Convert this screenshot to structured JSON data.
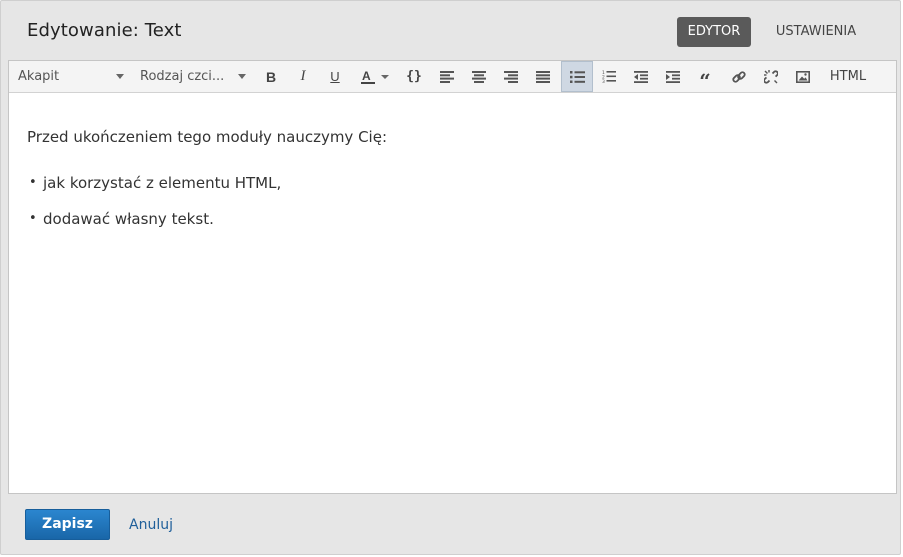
{
  "dialog": {
    "title": "Edytowanie: Text",
    "tabs": [
      {
        "label": "EDYTOR",
        "active": true
      },
      {
        "label": "USTAWIENIA",
        "active": false
      }
    ]
  },
  "toolbar": {
    "paragraph_dropdown": "Akapit",
    "font_dropdown": "Rodzaj czci...",
    "html_label": "HTML",
    "active_tool": "bullet-list",
    "icons": [
      "bold-icon",
      "italic-icon",
      "underline-icon",
      "text-color-icon",
      "code-icon",
      "align-left-icon",
      "align-center-icon",
      "align-right-icon",
      "align-justify-icon",
      "bullet-list-icon",
      "numbered-list-icon",
      "outdent-icon",
      "indent-icon",
      "blockquote-icon",
      "link-icon",
      "unlink-icon",
      "image-icon"
    ]
  },
  "content": {
    "intro": "Przed ukończeniem tego moduły nauczymy Cię:",
    "bullets": [
      "jak korzystać z elementu HTML,",
      "dodawać własny tekst."
    ]
  },
  "footer": {
    "save_label": "Zapisz",
    "cancel_label": "Anuluj"
  },
  "colors": {
    "primary": "#1f74bb",
    "tab_active_bg": "#5a5a5a",
    "toolbar_active_bg": "#cfd8e3"
  }
}
